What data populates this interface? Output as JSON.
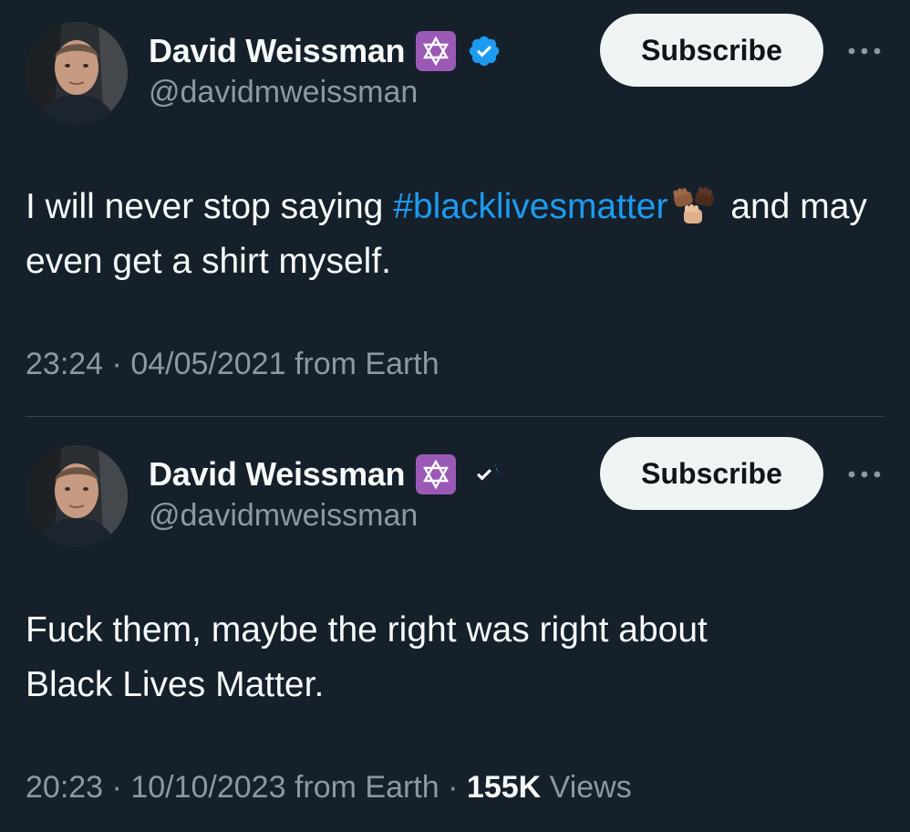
{
  "tweets": [
    {
      "author": {
        "display_name": "David Weissman",
        "handle": "@davidmweissman",
        "badge_icon": "star-of-david-icon",
        "verified_icon": "verified-badge-icon"
      },
      "subscribe_label": "Subscribe",
      "more_icon": "more-options-icon",
      "text": {
        "before": "I will never stop saying ",
        "hashtag": "#blacklivesmatter",
        "emoji": "raised-fists-emoji",
        "after": " and may even get a shirt myself."
      },
      "meta": {
        "time": "23:24",
        "date": "04/05/2021",
        "source": "from Earth"
      }
    },
    {
      "author": {
        "display_name": "David Weissman",
        "handle": "@davidmweissman",
        "badge_icon": "star-of-david-icon",
        "verified_icon": "verified-badge-icon"
      },
      "subscribe_label": "Subscribe",
      "more_icon": "more-options-icon",
      "text": {
        "line1": "Fuck them, maybe the right was right about",
        "line2": "Black Lives Matter."
      },
      "meta": {
        "time": "20:23",
        "date": "10/10/2023",
        "source": "from Earth",
        "views_count": "155K",
        "views_label": "Views"
      }
    }
  ],
  "colors": {
    "background": "#15202b",
    "text": "#f7f9f9",
    "secondary": "#8b98a5",
    "link": "#1d9bf0",
    "badge_purple": "#9b59b6",
    "verified_blue": "#1d9bf0"
  }
}
